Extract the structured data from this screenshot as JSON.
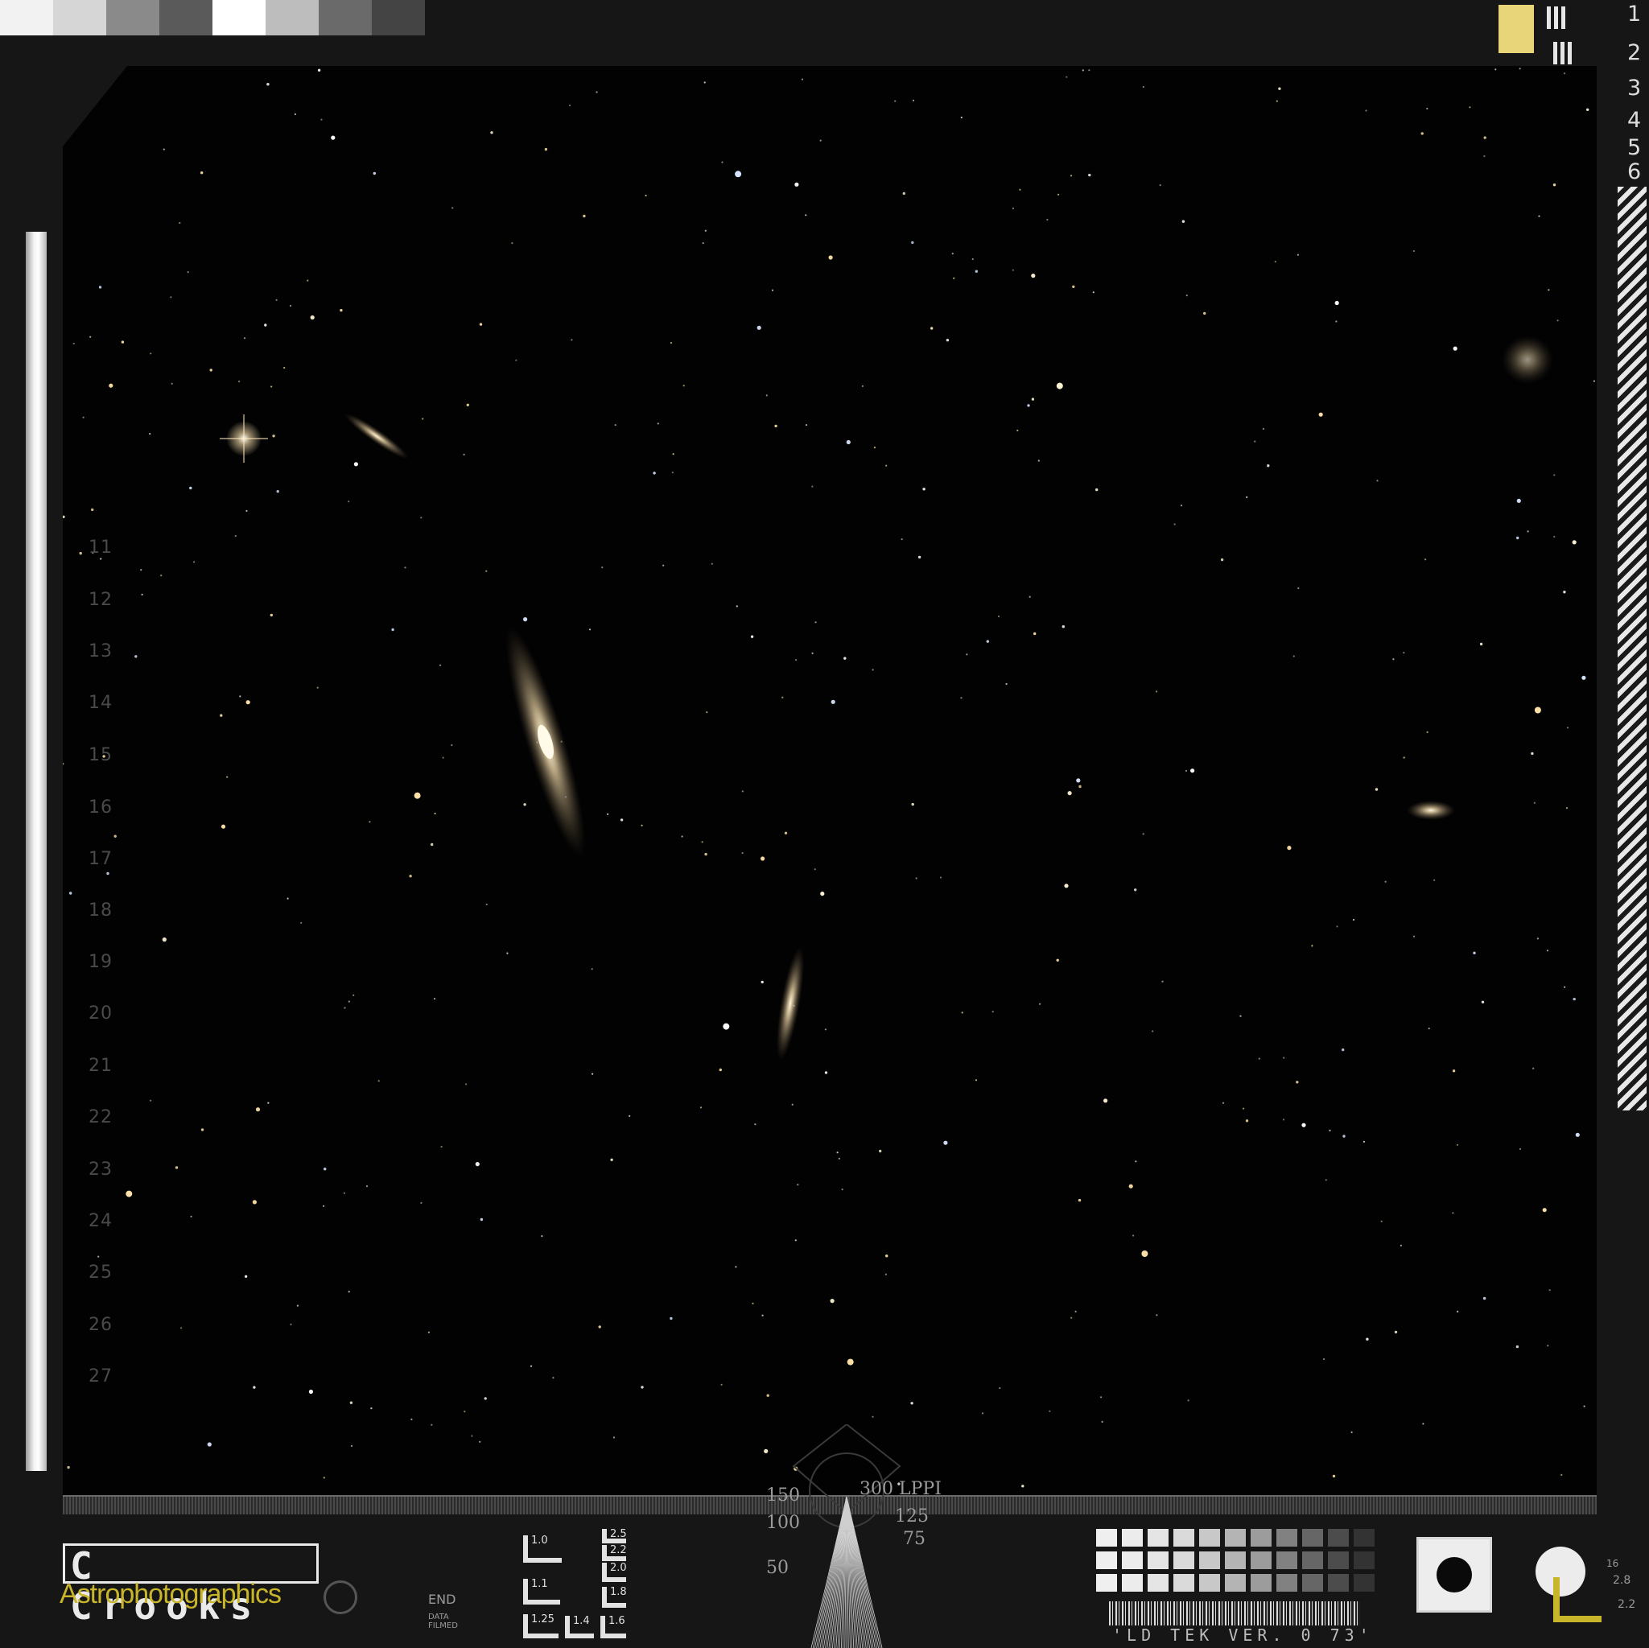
{
  "photo": {
    "subject": "deep-sky-star-field",
    "colors": {
      "sky": "#020203",
      "star": "#ffffff",
      "galaxy": "#d9c49a",
      "frame": "#161616"
    }
  },
  "ruler": {
    "numbers": [
      "11",
      "12",
      "13",
      "14",
      "15",
      "16",
      "17",
      "18",
      "19",
      "20",
      "21",
      "22",
      "23",
      "24",
      "25",
      "26",
      "27"
    ]
  },
  "resolution_target": {
    "labels": [
      "1",
      "2",
      "3",
      "4",
      "5",
      "6"
    ]
  },
  "bottom": {
    "brand": {
      "name": "C Crooks",
      "sub": "Astrophotographics"
    },
    "end_label": "END",
    "film_label": "DATA FILMED",
    "mini_labels": [
      "1.0",
      "1.1",
      "1.25",
      "1.4",
      "1.6",
      "1.8",
      "2.0",
      "2.2",
      "2.5"
    ],
    "lppi": {
      "title": "300 LPPI",
      "values": [
        "150",
        "125",
        "100",
        "75",
        "50"
      ]
    },
    "version": "'LD TEK VER. 0 73'",
    "scale_labels": [
      "16",
      "2.8",
      "2.2"
    ]
  }
}
